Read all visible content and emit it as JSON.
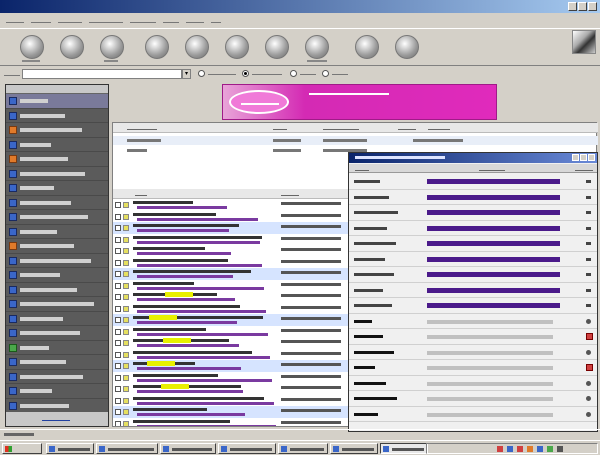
{
  "window": {
    "title": ""
  },
  "menu": {
    "items": [
      "",
      "",
      "",
      "",
      "",
      "",
      "",
      ""
    ]
  },
  "toolbar": {
    "buttons": [
      "",
      "",
      "",
      "",
      "",
      "",
      "",
      "",
      "",
      ""
    ]
  },
  "address": {
    "label": "",
    "value": "",
    "options": [
      "",
      "",
      "",
      ""
    ],
    "selected_option": 0
  },
  "left_pane": {
    "header": "",
    "items": [
      "",
      "",
      "",
      "",
      "",
      "",
      "",
      "",
      "",
      "",
      "",
      "",
      "",
      "",
      "",
      "",
      "",
      "",
      "",
      "",
      "",
      ""
    ],
    "footer_link": ""
  },
  "banner": {
    "logo_text": "",
    "headline": "",
    "colors": {
      "background": "#d42ab4"
    }
  },
  "top_table": {
    "columns": [
      "",
      "",
      "",
      "",
      ""
    ],
    "rows": [
      [
        "",
        "",
        "",
        "",
        ""
      ],
      [
        "",
        "",
        "",
        "",
        ""
      ]
    ]
  },
  "result_list": {
    "columns": [
      "",
      ""
    ],
    "rows": [
      {
        "title": "",
        "snippet": "",
        "url": ""
      },
      {
        "title": "",
        "snippet": "",
        "url": ""
      },
      {
        "title": "",
        "snippet": "",
        "url": ""
      },
      {
        "title": "",
        "snippet": "",
        "url": ""
      },
      {
        "title": "",
        "snippet": "",
        "url": ""
      },
      {
        "title": "",
        "snippet": "",
        "url": ""
      },
      {
        "title": "",
        "snippet": "",
        "url": ""
      },
      {
        "title": "",
        "snippet": "",
        "url": ""
      },
      {
        "title": "",
        "snippet": "",
        "url": ""
      },
      {
        "title": "",
        "snippet": "",
        "url": ""
      },
      {
        "title": "",
        "snippet": "",
        "url": ""
      },
      {
        "title": "",
        "snippet": "",
        "url": ""
      },
      {
        "title": "",
        "snippet": "",
        "url": ""
      },
      {
        "title": "",
        "snippet": "",
        "url": ""
      },
      {
        "title": "",
        "snippet": "",
        "url": ""
      },
      {
        "title": "",
        "snippet": "",
        "url": ""
      },
      {
        "title": "",
        "snippet": "",
        "url": ""
      },
      {
        "title": "",
        "snippet": "",
        "url": ""
      },
      {
        "title": "",
        "snippet": "",
        "url": ""
      },
      {
        "title": "",
        "snippet": "",
        "url": ""
      }
    ],
    "highlight_color": "#e8f000"
  },
  "progress_window": {
    "title": "",
    "columns": [
      "",
      "",
      ""
    ],
    "engines": [
      {
        "name": "",
        "progress": 0.95,
        "count": ""
      },
      {
        "name": "",
        "progress": 0.95,
        "count": ""
      },
      {
        "name": "",
        "progress": 0.95,
        "count": ""
      },
      {
        "name": "",
        "progress": 0.95,
        "count": ""
      },
      {
        "name": "",
        "progress": 0.95,
        "count": ""
      },
      {
        "name": "",
        "progress": 0.95,
        "count": ""
      },
      {
        "name": "",
        "progress": 0.95,
        "count": ""
      },
      {
        "name": "",
        "progress": 0.95,
        "count": ""
      },
      {
        "name": "",
        "progress": 0.95,
        "count": ""
      }
    ],
    "groups": [
      {
        "name": "",
        "progress": 0.9
      },
      {
        "name": "",
        "progress": 0.9
      },
      {
        "name": "",
        "progress": 0.9
      },
      {
        "name": "",
        "progress": 0.9
      },
      {
        "name": "",
        "progress": 0.9
      },
      {
        "name": "",
        "progress": 0.9
      },
      {
        "name": "",
        "progress": 0.9
      }
    ],
    "bar_color": "#4a1a8a"
  },
  "status": {
    "text": ""
  },
  "taskbar": {
    "start_label": "",
    "tasks": [
      "",
      "",
      "",
      "",
      "",
      "",
      ""
    ],
    "active_task": 6
  }
}
